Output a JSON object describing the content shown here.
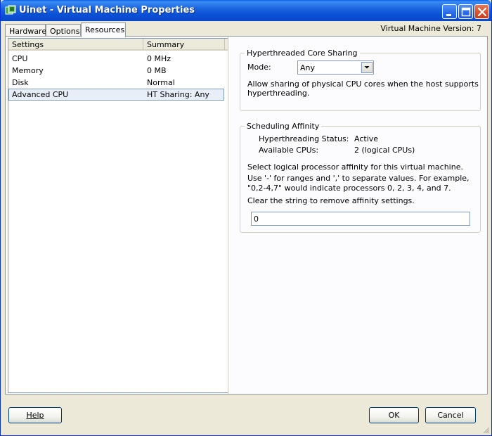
{
  "window": {
    "title": "Uinet - Virtual Machine Properties",
    "version_label": "Virtual Machine Version: 7"
  },
  "tabs": [
    {
      "label": "Hardware",
      "active": false
    },
    {
      "label": "Options",
      "active": false
    },
    {
      "label": "Resources",
      "active": true
    }
  ],
  "settings_table": {
    "headers": [
      "Settings",
      "Summary"
    ],
    "rows": [
      {
        "setting": "CPU",
        "summary": "0 MHz",
        "selected": false
      },
      {
        "setting": "Memory",
        "summary": "0 MB",
        "selected": false
      },
      {
        "setting": "Disk",
        "summary": "Normal",
        "selected": false
      },
      {
        "setting": "Advanced CPU",
        "summary": "HT Sharing: Any",
        "selected": true
      }
    ]
  },
  "ht_sharing": {
    "title": "Hyperthreaded Core Sharing",
    "mode_label": "Mode:",
    "mode_value": "Any",
    "description_line1": "Allow sharing of physical CPU cores when the host supports",
    "description_line2": "hyperthreading."
  },
  "scheduling_affinity": {
    "title": "Scheduling Affinity",
    "ht_status_label": "Hyperthreading Status:",
    "ht_status_value": "Active",
    "available_cpus_label": "Available CPUs:",
    "available_cpus_value": "2 (logical CPUs)",
    "instruction1": "Select logical processor affinity for this virtual machine.",
    "instruction2": "Use '-' for ranges and ',' to separate values. For example,",
    "instruction3": "\"0,2-4,7\" would indicate processors 0, 2, 3, 4, and 7.",
    "instruction4": "Clear the string to remove affinity settings.",
    "affinity_value": "0"
  },
  "buttons": {
    "help": "Help",
    "ok": "OK",
    "cancel": "Cancel"
  },
  "colors": {
    "titlebar": "#0a50d6",
    "window_bg": "#ece9d8",
    "panel_bg": "#fcfcfe",
    "selection_bg": "#e8eef8"
  }
}
